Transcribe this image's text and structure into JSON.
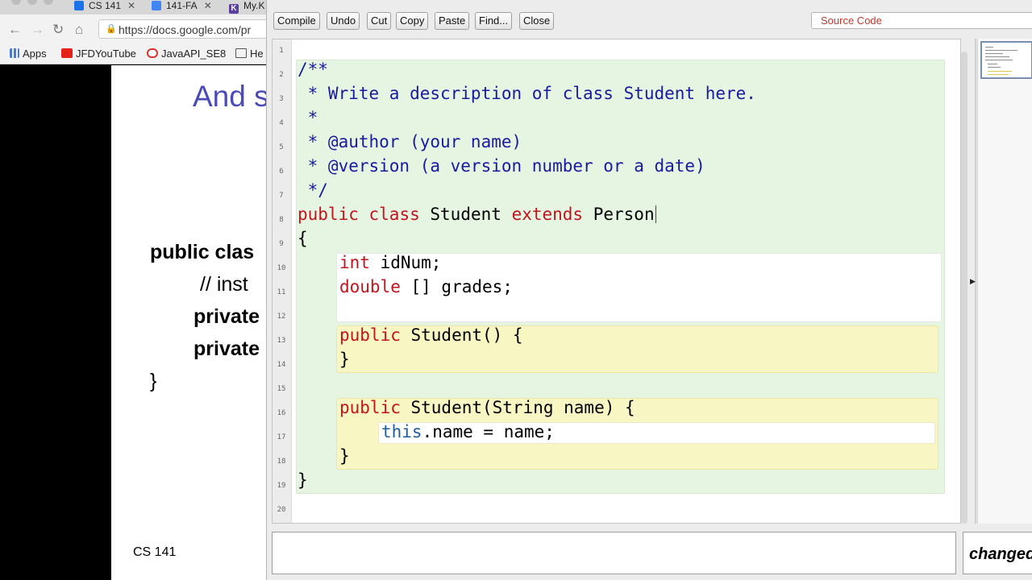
{
  "browser": {
    "tabs": [
      {
        "label": "CS 141",
        "color": "#1a73e8"
      },
      {
        "label": "141-FA",
        "color": "#4285f4"
      },
      {
        "label": "My.K",
        "color": "#5a3fa0"
      }
    ],
    "url": "https://docs.google.com/pr",
    "bookmarks": [
      {
        "label": "Apps",
        "icon": "apps-grid-icon"
      },
      {
        "label": "JFDYouTube",
        "icon": "youtube-icon",
        "color": "#e62117"
      },
      {
        "label": "JavaAPI_SE8",
        "icon": "oracle-icon",
        "color": "#d8362e"
      },
      {
        "label": "He",
        "icon": "folder-icon"
      }
    ]
  },
  "slide": {
    "title": "And s",
    "lines": [
      "public clas",
      "// inst",
      "private",
      "private",
      "}"
    ],
    "footer": "CS 141"
  },
  "editor": {
    "toolbar": [
      "Compile",
      "Undo",
      "Cut",
      "Copy",
      "Paste",
      "Find...",
      "Close"
    ],
    "view_select": "Source Code",
    "line_numbers": [
      "1",
      "2",
      "3",
      "4",
      "5",
      "6",
      "7",
      "8",
      "9",
      "10",
      "11",
      "12",
      "13",
      "14",
      "15",
      "16",
      "17",
      "18",
      "19",
      "20"
    ],
    "code": {
      "l2": "/**",
      "l3": " * Write a description of class Student here.",
      "l4": " *",
      "l5": " * @author (your name)",
      "l6": " * @version (a version number or a date)",
      "l7": " */",
      "l8_kw1": "public",
      "l8_kw2": "class",
      "l8_name": "Student",
      "l8_kw3": "extends",
      "l8_parent": "Person",
      "l9": "{",
      "l10_kw": "int",
      "l10_rest": " idNum;",
      "l11_kw": "double",
      "l11_rest": " [] grades;",
      "l13_kw": "public",
      "l13_rest": " Student() {",
      "l14": "}",
      "l16_kw": "public",
      "l16_rest": " Student(String name) {",
      "l17_kw": "this",
      "l17_rest": ".name = name;",
      "l18": "}",
      "l19": "}"
    },
    "status": "changed"
  },
  "colors": {
    "keyword": "#c0141e",
    "comment": "#1a1aa0",
    "this_keyword": "#1f5c9e",
    "class_scope": "#e5f5e1",
    "method_scope": "#f8f6c2"
  }
}
